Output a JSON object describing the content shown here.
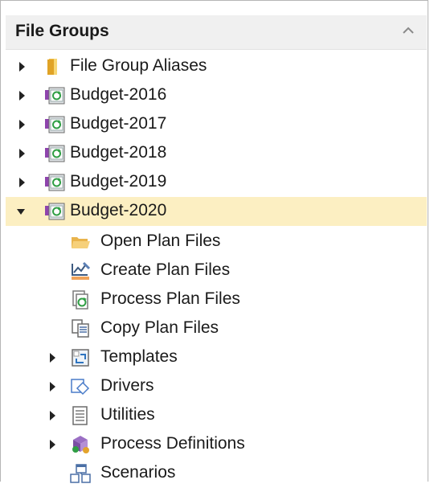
{
  "panel": {
    "title": "File Groups",
    "collapse_icon": "chevron-up-icon"
  },
  "tree": {
    "items": [
      {
        "label": "File Group Aliases",
        "icon": "folder-icon",
        "expander": "collapsed"
      },
      {
        "label": "Budget-2016",
        "icon": "file-group-icon",
        "expander": "collapsed"
      },
      {
        "label": "Budget-2017",
        "icon": "file-group-icon",
        "expander": "collapsed"
      },
      {
        "label": "Budget-2018",
        "icon": "file-group-icon",
        "expander": "collapsed"
      },
      {
        "label": "Budget-2019",
        "icon": "file-group-icon",
        "expander": "collapsed"
      },
      {
        "label": "Budget-2020",
        "icon": "file-group-icon",
        "expander": "expanded",
        "selected": true
      },
      {
        "label": "Open Plan Files",
        "icon": "open-folder-icon"
      },
      {
        "label": "Create Plan Files",
        "icon": "create-plan-icon"
      },
      {
        "label": "Process Plan Files",
        "icon": "process-plan-icon"
      },
      {
        "label": "Copy Plan Files",
        "icon": "copy-plan-icon"
      },
      {
        "label": "Templates",
        "icon": "templates-icon",
        "expander": "collapsed"
      },
      {
        "label": "Drivers",
        "icon": "drivers-icon",
        "expander": "collapsed"
      },
      {
        "label": "Utilities",
        "icon": "utilities-icon",
        "expander": "collapsed"
      },
      {
        "label": "Process Definitions",
        "icon": "process-definitions-icon",
        "expander": "collapsed"
      },
      {
        "label": "Scenarios",
        "icon": "scenarios-icon"
      }
    ]
  },
  "colors": {
    "selection": "#fcefc2",
    "header_bg": "#f0f0f0",
    "accent_green": "#2f9e44"
  }
}
